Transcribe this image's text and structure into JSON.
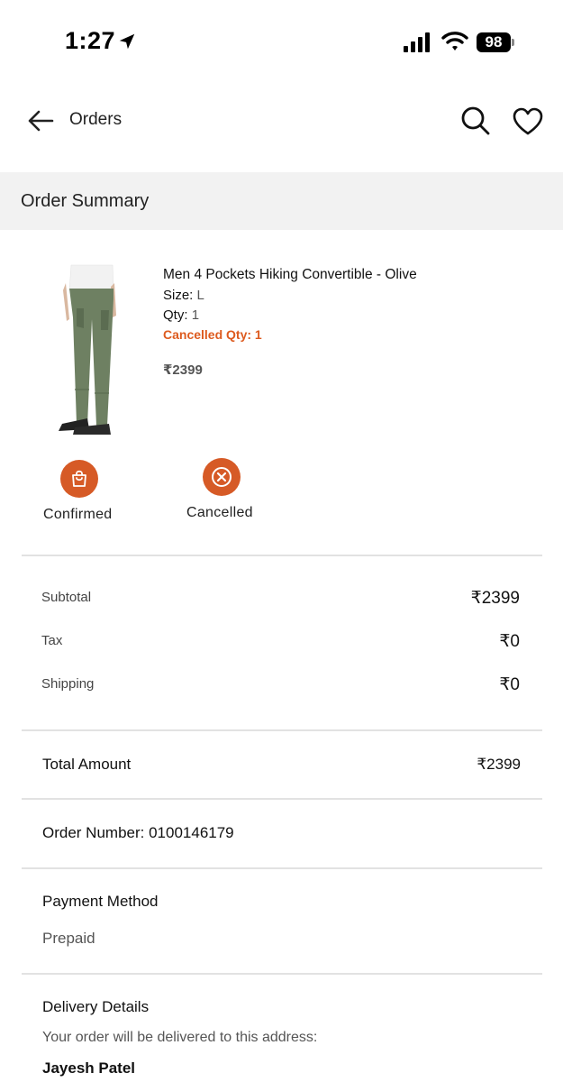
{
  "status_bar": {
    "time": "1:27",
    "battery": "98"
  },
  "topbar": {
    "title": "Orders",
    "icons": [
      "back-arrow-icon",
      "search-icon",
      "heart-icon"
    ]
  },
  "summary": {
    "title": "Order Summary"
  },
  "product": {
    "name": "Men 4 Pockets Hiking Convertible - Olive",
    "size_label": "Size:",
    "size_value": "L",
    "qty_label": "Qty:",
    "qty_value": "1",
    "cancelled_qty": "Cancelled Qty: 1",
    "price": "₹2399",
    "image_colors": {
      "pants": "#6e8062",
      "shirt": "#f2f2f2",
      "shoes": "#222222"
    }
  },
  "statuses": [
    {
      "label": "Confirmed",
      "icon": "shopping-bag-icon"
    },
    {
      "label": "Cancelled",
      "icon": "close-circle-icon"
    }
  ],
  "price_breakdown": [
    {
      "label": "Subtotal",
      "value": "₹2399"
    },
    {
      "label": "Tax",
      "value": "₹0"
    },
    {
      "label": "Shipping",
      "value": "₹0"
    }
  ],
  "total": {
    "label": "Total Amount",
    "value": "₹2399"
  },
  "order": {
    "number_text": "Order Number: 0100146179"
  },
  "payment": {
    "title": "Payment Method",
    "value": "Prepaid"
  },
  "delivery": {
    "title": "Delivery Details",
    "note": "Your order will be delivered to this address:",
    "name": "Jayesh Patel"
  },
  "colors": {
    "accent": "#d65a26",
    "cancelled_text": "#dd5b1f",
    "section_bg": "#f2f2f2",
    "divider": "#e2e2e2"
  }
}
